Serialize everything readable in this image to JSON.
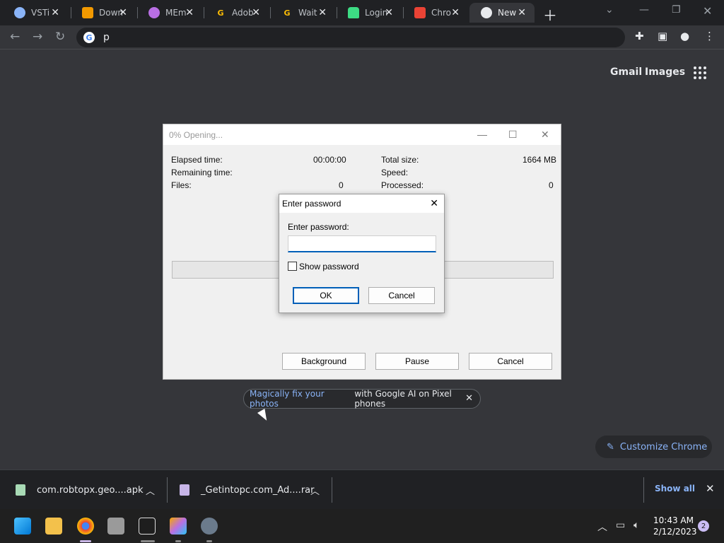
{
  "browser": {
    "tabs": [
      {
        "title": "VSTi",
        "favicon_color": "#8ab4f8",
        "favicon_glyph": ""
      },
      {
        "title": "Down",
        "favicon_color": "#f29900",
        "favicon_glyph": ""
      },
      {
        "title": "MEm",
        "favicon_color": "#b96fe4",
        "favicon_glyph": ""
      },
      {
        "title": "Adob",
        "favicon_color": "#202124",
        "favicon_glyph": "G"
      },
      {
        "title": "Wait",
        "favicon_color": "#202124",
        "favicon_glyph": "G"
      },
      {
        "title": "Login",
        "favicon_color": "#3ddc84",
        "favicon_glyph": ""
      },
      {
        "title": "Chro",
        "favicon_color": "#ea4335",
        "favicon_glyph": ""
      },
      {
        "title": "New",
        "favicon_color": "#e8eaed",
        "favicon_glyph": ""
      }
    ],
    "omnibox_text": "p",
    "ntp_links": {
      "gmail": "Gmail",
      "images": "Images"
    }
  },
  "extract_window": {
    "title": "0% Opening...",
    "stats": {
      "elapsed_label": "Elapsed time:",
      "elapsed_value": "00:00:00",
      "remaining_label": "Remaining time:",
      "files_label": "Files:",
      "files_value": "0",
      "total_label": "Total size:",
      "total_value": "1664 MB",
      "speed_label": "Speed:",
      "processed_label": "Processed:",
      "processed_value": "0"
    },
    "progress_fraction": 0,
    "buttons": {
      "background": "Background",
      "pause": "Pause",
      "cancel": "Cancel"
    }
  },
  "password_dialog": {
    "title": "Enter password",
    "label": "Enter password:",
    "value": "",
    "show_password_label": "Show password",
    "ok": "OK",
    "cancel": "Cancel"
  },
  "promo": {
    "highlight": "Magically fix your photos",
    "rest": "with Google AI on Pixel phones"
  },
  "customize_label": "Customize Chrome",
  "downloads": {
    "items": [
      "com.robtopx.geo....apk",
      "_Getintopc.com_Ad....rar"
    ],
    "show_all": "Show all"
  },
  "taskbar": {
    "time": "10:43 AM",
    "date": "2/12/2023",
    "notification_count": "2"
  },
  "colors": {
    "accent_blue": "#8ab4f8",
    "dialog_focus": "#005fb8"
  }
}
